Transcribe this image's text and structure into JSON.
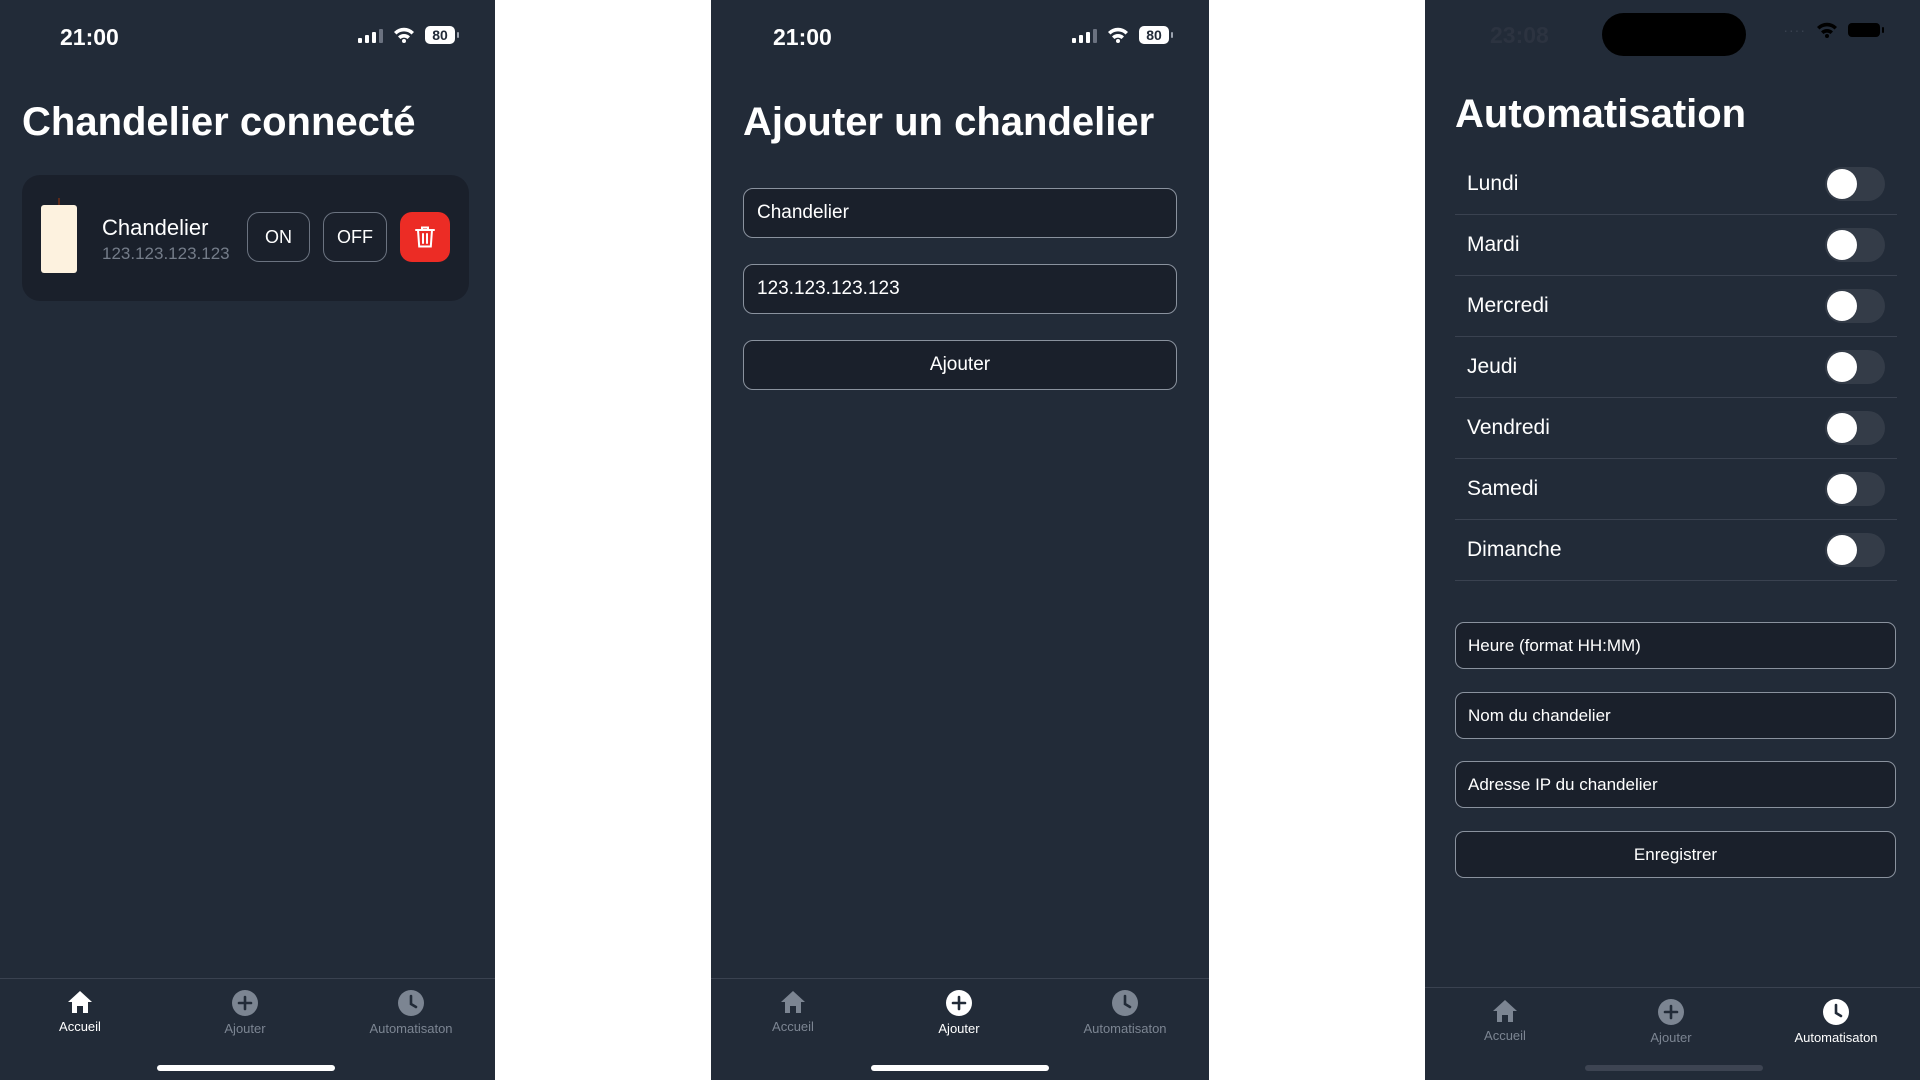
{
  "status_bar_1": {
    "time": "21:00",
    "battery": "80"
  },
  "status_bar_2": {
    "time": "21:00",
    "battery": "80"
  },
  "status_bar_3": {
    "time": "23:08",
    "dots": "····"
  },
  "home": {
    "title": "Chandelier connecté",
    "device": {
      "name": "Chandelier",
      "ip": "123.123.123.123",
      "on_label": "ON",
      "off_label": "OFF"
    }
  },
  "add": {
    "title": "Ajouter un chandelier",
    "name_value": "Chandelier",
    "ip_value": "123.123.123.123",
    "submit_label": "Ajouter"
  },
  "automation": {
    "title": "Automatisation",
    "days": [
      {
        "label": "Lundi",
        "enabled": false
      },
      {
        "label": "Mardi",
        "enabled": false
      },
      {
        "label": "Mercredi",
        "enabled": false
      },
      {
        "label": "Jeudi",
        "enabled": false
      },
      {
        "label": "Vendredi",
        "enabled": false
      },
      {
        "label": "Samedi",
        "enabled": false
      },
      {
        "label": "Dimanche",
        "enabled": false
      }
    ],
    "time_placeholder": "Heure (format HH:MM)",
    "name_placeholder": "Nom du chandelier",
    "ip_placeholder": "Adresse IP du chandelier",
    "save_label": "Enregistrer"
  },
  "tabs": {
    "home": "Accueil",
    "add": "Ajouter",
    "automation": "Automatisaton"
  },
  "colors": {
    "background": "#222b38",
    "card": "#1a202b",
    "delete": "#ec2c25",
    "candle": "#fdf2df"
  }
}
